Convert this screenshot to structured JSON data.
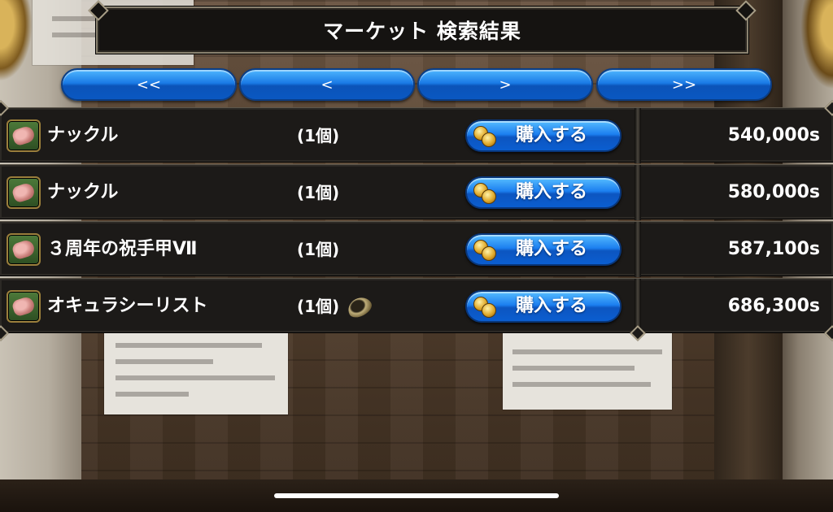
{
  "header": {
    "title": "マーケット 検索結果"
  },
  "pager": {
    "first_label": "<<",
    "prev_label": "<",
    "next_label": ">",
    "last_label": ">>"
  },
  "listings": [
    {
      "icon": "knuckle-icon",
      "name": "ナックル",
      "quantity": "(1個)",
      "buy_label": "購入する",
      "price": "540,000s",
      "seed_icon": false
    },
    {
      "icon": "knuckle-icon",
      "name": "ナックル",
      "quantity": "(1個)",
      "buy_label": "購入する",
      "price": "580,000s",
      "seed_icon": false
    },
    {
      "icon": "knuckle-icon",
      "name": "３周年の祝手甲Ⅶ",
      "quantity": "(1個)",
      "buy_label": "購入する",
      "price": "587,100s",
      "seed_icon": false
    },
    {
      "icon": "knuckle-icon",
      "name": "オキュラシーリスト",
      "quantity": "(1個)",
      "buy_label": "購入する",
      "price": "686,300s",
      "seed_icon": true
    }
  ],
  "icons": {
    "buy_button": "coins-icon",
    "seed": "seed-icon"
  },
  "colors": {
    "button_blue": "#1c7ff0",
    "row_background": "#1c1a18",
    "frame_border": "#8a8270",
    "text": "#ffffff"
  }
}
